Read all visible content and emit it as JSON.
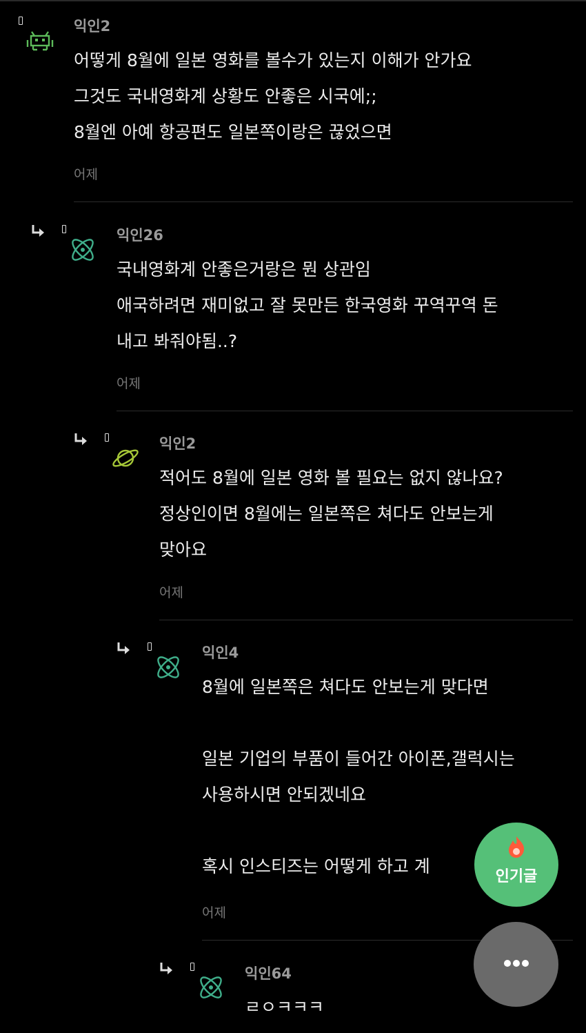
{
  "colors": {
    "accent_green": "#55c078",
    "fab_more_bg": "#6a6a6a",
    "background": "#000000"
  },
  "comments": [
    {
      "author": "익인2",
      "avatar_icon": "space-invader-icon",
      "lines": [
        "어떻게 8월에 일본 영화를 볼수가 있는지 이해가 안가요",
        "그것도 국내영화계 상황도 안좋은 시국에;;",
        "8월엔 아예 항공편도 일본쪽이랑은 끊었으면"
      ],
      "time": "어제"
    },
    {
      "author": "익인26",
      "avatar_icon": "atom-icon",
      "lines": [
        "국내영화계 안좋은거랑은 뭔 상관임",
        "애국하려면 재미없고 잘 못만든 한국영화 꾸역꾸역 돈",
        "내고 봐줘야됨..?"
      ],
      "time": "어제"
    },
    {
      "author": "익인2",
      "avatar_icon": "planet-icon",
      "lines": [
        "적어도 8월에 일본 영화 볼 필요는 없지 않나요?",
        "정상인이면 8월에는 일본쪽은 쳐다도 안보는게",
        "맞아요"
      ],
      "time": "어제"
    },
    {
      "author": "익인4",
      "avatar_icon": "atom-icon",
      "lines": [
        "8월에 일본쪽은 쳐다도 안보는게 맞다면",
        "",
        "일본 기업의 부품이 들어간 아이폰,갤럭시는",
        "사용하시면 안되겠네요",
        "",
        "혹시 인스티즈는 어떻게 하고 계"
      ],
      "time": "어제"
    },
    {
      "author": "익인64",
      "avatar_icon": "atom-icon",
      "lines": [
        "ㄹㅇㅋㅋㅋ"
      ],
      "time": ""
    }
  ],
  "fab": {
    "hot_label": "인기글",
    "hot_icon": "flame-icon",
    "more_icon": "more-dots-icon"
  }
}
